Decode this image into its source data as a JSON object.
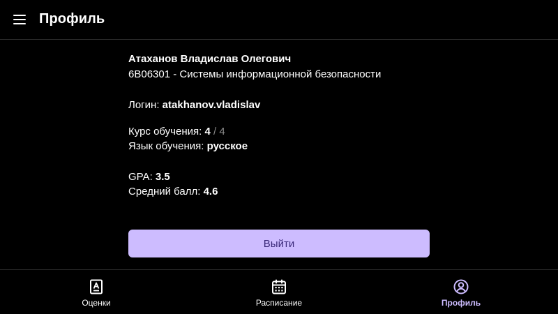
{
  "header": {
    "title": "Профиль",
    "menu_icon": "hamburger-menu-icon"
  },
  "profile": {
    "full_name": "Атаханов Владислав Олегович",
    "program": "6B06301 - Системы информационной безопасности",
    "login_label": "Логин:",
    "login_value": "atakhanov.vladislav",
    "course_label": "Курс обучения:",
    "course_current": "4",
    "course_total": "/ 4",
    "language_label": "Язык обучения:",
    "language_value": "русское",
    "gpa_label": "GPA:",
    "gpa_value": "3.5",
    "avg_label": "Средний балл:",
    "avg_value": "4.6"
  },
  "actions": {
    "logout_label": "Выйти"
  },
  "bottom_nav": {
    "items": [
      {
        "label": "Оценки",
        "icon": "grades-icon",
        "active": false
      },
      {
        "label": "Расписание",
        "icon": "calendar-icon",
        "active": false
      },
      {
        "label": "Профиль",
        "icon": "user-profile-icon",
        "active": true
      }
    ]
  },
  "colors": {
    "background": "#000000",
    "accent": "#cdbcff",
    "button_text": "#3b2a7a",
    "muted": "#8c8c8c",
    "divider": "#2c2c2c"
  }
}
